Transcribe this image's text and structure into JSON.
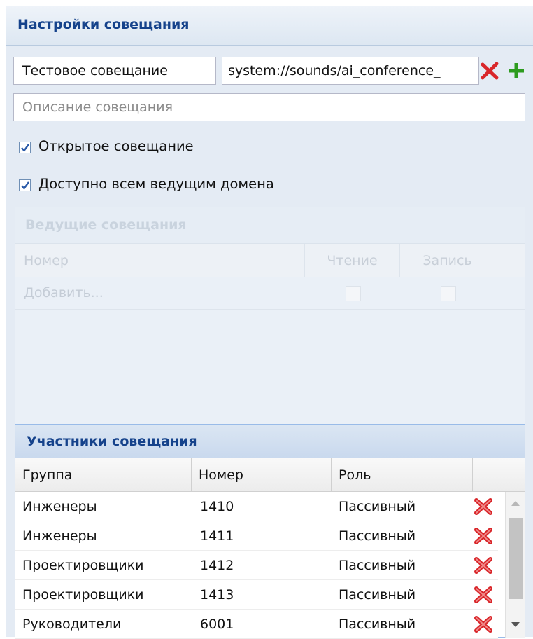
{
  "panel": {
    "title": "Настройки совещания"
  },
  "form": {
    "name_value": "Тестовое совещание",
    "sound_value": "system://sounds/ai_conference_",
    "description_placeholder": "Описание совещания",
    "open_label": "Открытое совещание",
    "open_checked": true,
    "domain_label": "Доступно всем ведущим домена",
    "domain_checked": true
  },
  "hosts": {
    "title": "Ведущие совещания",
    "columns": [
      "Номер",
      "Чтение",
      "Запись"
    ],
    "add_text": "Добавить..."
  },
  "participants": {
    "title": "Участники совещания",
    "columns": [
      "Группа",
      "Номер",
      "Роль"
    ],
    "rows": [
      {
        "group": "Инженеры",
        "number": "1410",
        "role": "Пассивный"
      },
      {
        "group": "Инженеры",
        "number": "1411",
        "role": "Пассивный"
      },
      {
        "group": "Проектировщики",
        "number": "1412",
        "role": "Пассивный"
      },
      {
        "group": "Проектировщики",
        "number": "1413",
        "role": "Пассивный"
      },
      {
        "group": "Руководители",
        "number": "6001",
        "role": "Пассивный"
      }
    ]
  },
  "icons": {
    "remove": "red-x-icon",
    "add": "green-plus-icon",
    "check": "checkmark-icon"
  },
  "colors": {
    "header_text": "#15428b",
    "remove": "#d9262a",
    "add": "#2d9b1f",
    "panel_bg": "#e4ebf4"
  }
}
